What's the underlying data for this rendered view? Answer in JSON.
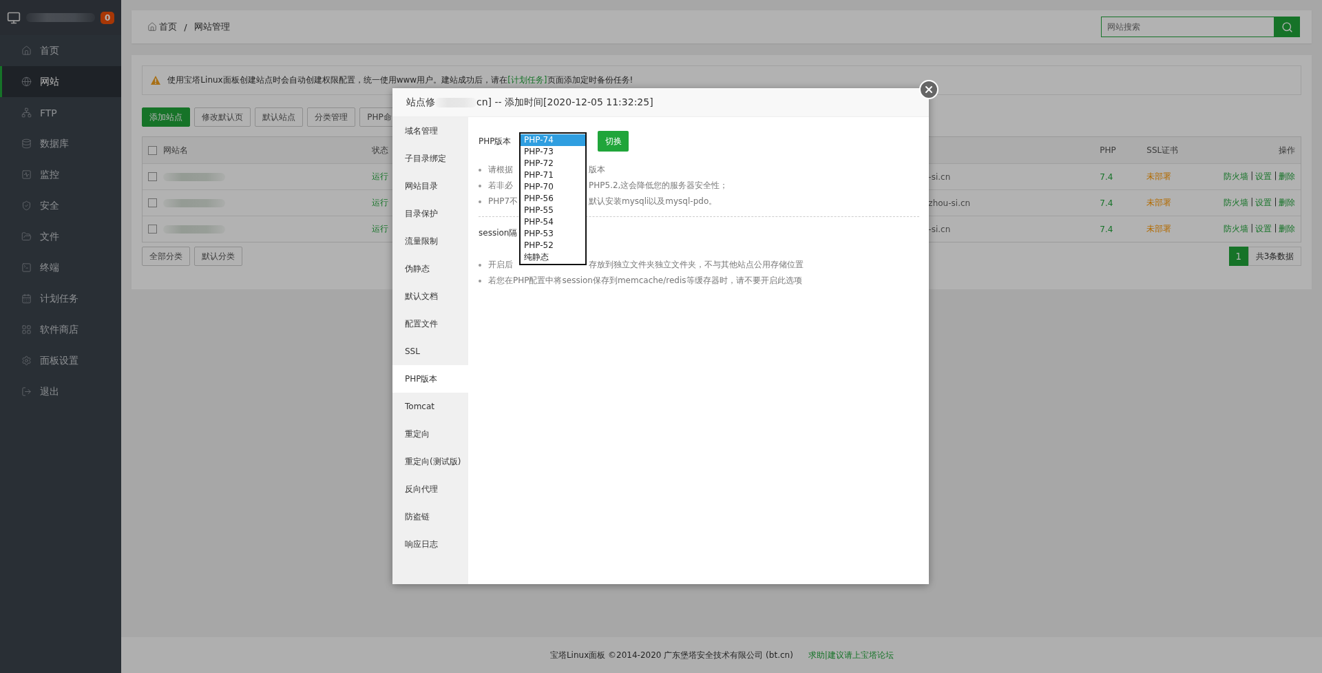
{
  "sidebar": {
    "alert_count": "0",
    "items": [
      {
        "label": "首页",
        "selected": false
      },
      {
        "label": "网站",
        "selected": true
      },
      {
        "label": "FTP",
        "selected": false
      },
      {
        "label": "数据库",
        "selected": false
      },
      {
        "label": "监控",
        "selected": false
      },
      {
        "label": "安全",
        "selected": false
      },
      {
        "label": "文件",
        "selected": false
      },
      {
        "label": "终端",
        "selected": false
      },
      {
        "label": "计划任务",
        "selected": false
      },
      {
        "label": "软件商店",
        "selected": false
      },
      {
        "label": "面板设置",
        "selected": false
      },
      {
        "label": "退出",
        "selected": false
      }
    ]
  },
  "breadcrumb": {
    "home": "首页",
    "separator": "/",
    "current": "网站管理"
  },
  "search": {
    "placeholder": "网站搜索"
  },
  "notice": {
    "before": "使用宝塔Linux面板创建站点时会自动创建权限配置，统一使用www用户。建站成功后，请在",
    "link": "[计划任务]",
    "after": "页面添加定时备份任务!"
  },
  "toolbar": [
    {
      "label": "添加站点",
      "kind": "primary"
    },
    {
      "label": "修改默认页",
      "kind": "default"
    },
    {
      "label": "默认站点",
      "kind": "default"
    },
    {
      "label": "分类管理",
      "kind": "default"
    },
    {
      "label": "PHP命",
      "kind": "default"
    }
  ],
  "table": {
    "all_checked": false,
    "columns": [
      "网站名",
      "状态",
      "PHP",
      "SSL证书",
      "操作"
    ],
    "rows": [
      {
        "checked": false,
        "status": "运行",
        "domain": "-si.cn",
        "php": "7.4",
        "ssl": "未部署",
        "actions": [
          {
            "label": "防火墙",
            "kind": "link"
          },
          {
            "label": "|",
            "kind": "separator"
          },
          {
            "label": "设置",
            "kind": "link"
          },
          {
            "label": "|",
            "kind": "separator"
          },
          {
            "label": "删除",
            "kind": "link"
          }
        ]
      },
      {
        "checked": false,
        "status": "运行",
        "domain": "zhou-si.cn",
        "php": "7.4",
        "ssl": "未部署",
        "actions": [
          {
            "label": "防火墙",
            "kind": "link"
          },
          {
            "label": "|",
            "kind": "separator"
          },
          {
            "label": "设置",
            "kind": "link"
          },
          {
            "label": "|",
            "kind": "separator"
          },
          {
            "label": "删除",
            "kind": "link"
          }
        ]
      },
      {
        "checked": false,
        "status": "运行",
        "domain": "-si.cn",
        "php": "7.4",
        "ssl": "未部署",
        "actions": [
          {
            "label": "防火墙",
            "kind": "link"
          },
          {
            "label": "|",
            "kind": "separator"
          },
          {
            "label": "设置",
            "kind": "link"
          },
          {
            "label": "|",
            "kind": "separator"
          },
          {
            "label": "删除",
            "kind": "link"
          }
        ]
      }
    ]
  },
  "category_buttons": [
    "全部分类",
    "默认分类"
  ],
  "pagination": {
    "pages": [
      {
        "label": "1",
        "selected": true
      }
    ],
    "summary": "共3条数据"
  },
  "footer": {
    "copyright": "宝塔Linux面板 ©2014-2020 广东堡塔安全技术有限公司 (bt.cn)",
    "link": "求助|建议请上宝塔论坛"
  },
  "modal": {
    "title_before": "站点修",
    "title_after": "cn] -- 添加时间[2020-12-05 11:32:25]",
    "tabs": [
      {
        "label": "域名管理",
        "selected": false
      },
      {
        "label": "子目录绑定",
        "selected": false
      },
      {
        "label": "网站目录",
        "selected": false
      },
      {
        "label": "目录保护",
        "selected": false
      },
      {
        "label": "流量限制",
        "selected": false
      },
      {
        "label": "伪静态",
        "selected": false
      },
      {
        "label": "默认文档",
        "selected": false
      },
      {
        "label": "配置文件",
        "selected": false
      },
      {
        "label": "SSL",
        "selected": false
      },
      {
        "label": "PHP版本",
        "selected": true
      },
      {
        "label": "Tomcat",
        "selected": false
      },
      {
        "label": "重定向",
        "selected": false
      },
      {
        "label": "重定向(测试版)",
        "selected": false
      },
      {
        "label": "反向代理",
        "selected": false
      },
      {
        "label": "防盗链",
        "selected": false
      },
      {
        "label": "响应日志",
        "selected": false
      }
    ],
    "php_label": "PHP版本",
    "versions": [
      {
        "label": "PHP-74",
        "selected": true
      },
      {
        "label": "PHP-73",
        "selected": false
      },
      {
        "label": "PHP-72",
        "selected": false
      },
      {
        "label": "PHP-71",
        "selected": false
      },
      {
        "label": "PHP-70",
        "selected": false
      },
      {
        "label": "PHP-56",
        "selected": false
      },
      {
        "label": "PHP-55",
        "selected": false
      },
      {
        "label": "PHP-54",
        "selected": false
      },
      {
        "label": "PHP-53",
        "selected": false
      },
      {
        "label": "PHP-52",
        "selected": false
      },
      {
        "label": "纯静态",
        "selected": false
      }
    ],
    "switch_button": "切换",
    "notes": [
      {
        "before": "请根据",
        "after": "版本"
      },
      {
        "before": "若非必",
        "after": "PHP5.2,这会降低您的服务器安全性；"
      },
      {
        "before": "PHP7不",
        "after": "默认安装mysqli以及mysql-pdo。"
      }
    ],
    "session_label": "session隔",
    "session_notes": [
      {
        "before": "开启后",
        "after": "存放到独立文件夹独立文件夹，不与其他站点公用存储位置"
      },
      {
        "before": "若您在PHP配置中将session保存到memcache/redis等缓存器时，请不要开启此选项"
      }
    ]
  }
}
